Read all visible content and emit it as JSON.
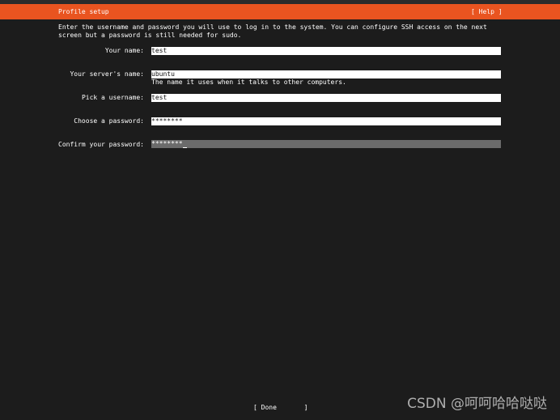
{
  "header": {
    "title": "Profile setup",
    "help_label": "[ Help ]",
    "accent_color": "#e95420"
  },
  "intro": {
    "line1": "Enter the username and password you will use to log in to the system. You can configure SSH access on the next",
    "line2": "screen but a password is still needed for sudo."
  },
  "fields": {
    "name": {
      "label": "Your name:",
      "value": "test"
    },
    "server": {
      "label": "Your server's name:",
      "value": "ubuntu",
      "help": "The name it uses when it talks to other computers."
    },
    "username": {
      "label": "Pick a username:",
      "value": "test"
    },
    "password": {
      "label": "Choose a password:",
      "value": "********"
    },
    "confirm": {
      "label": "Confirm your password:",
      "value": "********"
    }
  },
  "footer": {
    "done_label": "[ Done       ]"
  },
  "watermark": {
    "text": "CSDN @呵呵哈哈哒哒"
  }
}
